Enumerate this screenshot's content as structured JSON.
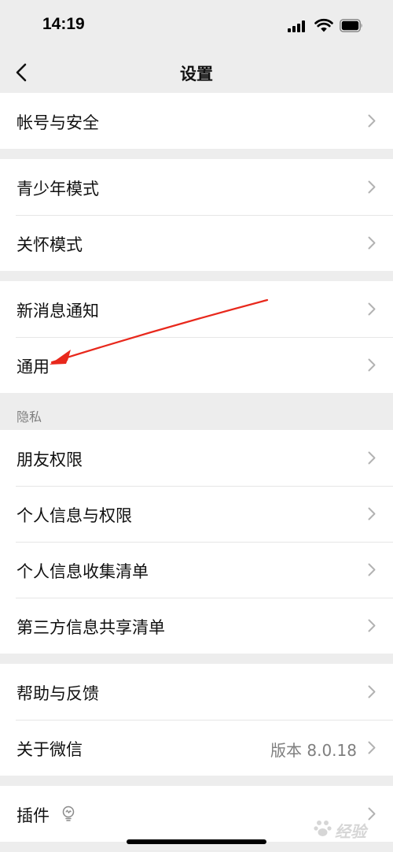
{
  "status_bar": {
    "time": "14:19"
  },
  "nav": {
    "title": "设置",
    "back_icon": "chevron-left-icon"
  },
  "groups": {
    "account": [
      {
        "label": "帐号与安全"
      }
    ],
    "modes": [
      {
        "label": "青少年模式"
      },
      {
        "label": "关怀模式"
      }
    ],
    "notify": [
      {
        "label": "新消息通知"
      },
      {
        "label": "通用"
      }
    ],
    "privacy": {
      "header": "隐私",
      "items": [
        {
          "label": "朋友权限"
        },
        {
          "label": "个人信息与权限"
        },
        {
          "label": "个人信息收集清单"
        },
        {
          "label": "第三方信息共享清单"
        }
      ]
    },
    "help": [
      {
        "label": "帮助与反馈"
      },
      {
        "label": "关于微信",
        "value": "版本 8.0.18"
      }
    ],
    "plugins": [
      {
        "label": "插件",
        "icon": "lightbulb-icon"
      }
    ]
  },
  "annotation": {
    "color": "#e8281c"
  },
  "watermark": {
    "text": "经验"
  },
  "colors": {
    "background": "#ededed",
    "row": "#ffffff",
    "secondary_text": "#7f7f7f",
    "chevron": "#b2b2b2"
  }
}
